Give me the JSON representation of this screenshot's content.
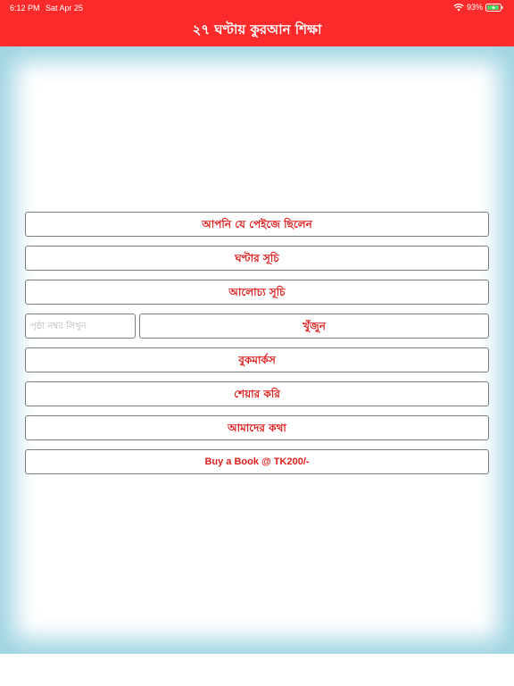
{
  "status_bar": {
    "time": "6:12 PM",
    "date": "Sat Apr 25",
    "battery_percent": "93%",
    "battery_level": 0.93,
    "wifi_icon": "wifi-icon",
    "battery_icon": "battery-charging-icon"
  },
  "header": {
    "title": "২৭ ঘণ্টায় কুরআন শিক্ষা",
    "background_color": "#fb2b2b"
  },
  "menu": {
    "last_page": "আপনি যে পেইজে ছিলেন",
    "hour_index": "ঘণ্টার সূচি",
    "topic_index": "আলোচ্য সূচি",
    "bookmarks": "বুকমার্কস",
    "share": "শেয়ার করি",
    "about": "আমাদের কথা",
    "buy_book": "Buy a Book @ TK200/-"
  },
  "search": {
    "placeholder": "পৃষ্ঠা নম্বর লিখুন",
    "value": "",
    "button_label": "খুঁজুন"
  },
  "colors": {
    "accent": "#d92020",
    "glow": "#9fd4e2"
  }
}
